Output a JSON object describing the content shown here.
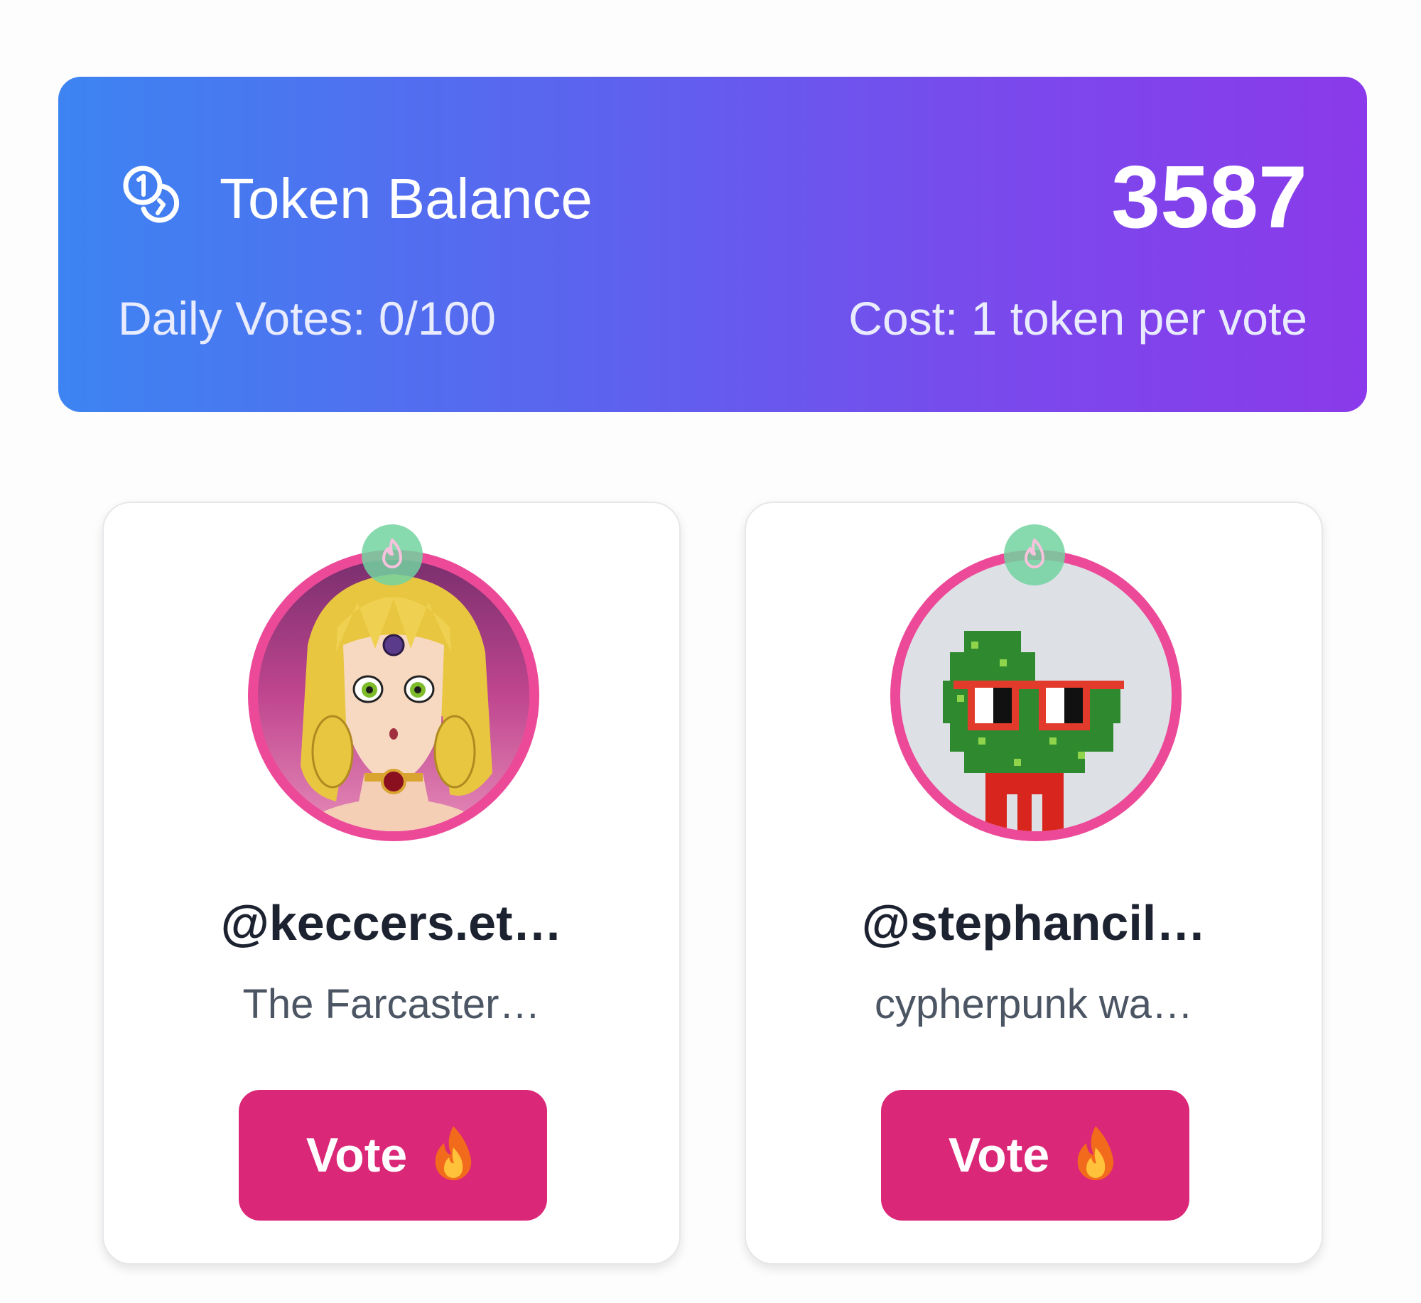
{
  "balance": {
    "title": "Token Balance",
    "value": "3587",
    "daily_votes": "Daily Votes: 0/100",
    "cost": "Cost: 1 token per vote",
    "icon": "coins-icon",
    "gradient_start": "#3d84f2",
    "gradient_end": "#8a3aea"
  },
  "cards": [
    {
      "username": "@keccers.et…",
      "bio": "The Farcaster…",
      "vote_label": "Vote",
      "avatar": "anime-girl-avatar",
      "badge_icon": "flame-icon"
    },
    {
      "username": "@stephancil…",
      "bio": "cypherpunk wa…",
      "vote_label": "Vote",
      "avatar": "pixel-cactus-avatar",
      "badge_icon": "flame-icon"
    }
  ],
  "colors": {
    "vote_button": "#db2777",
    "avatar_ring": "#ec4a98",
    "badge": "#72d2a0"
  }
}
